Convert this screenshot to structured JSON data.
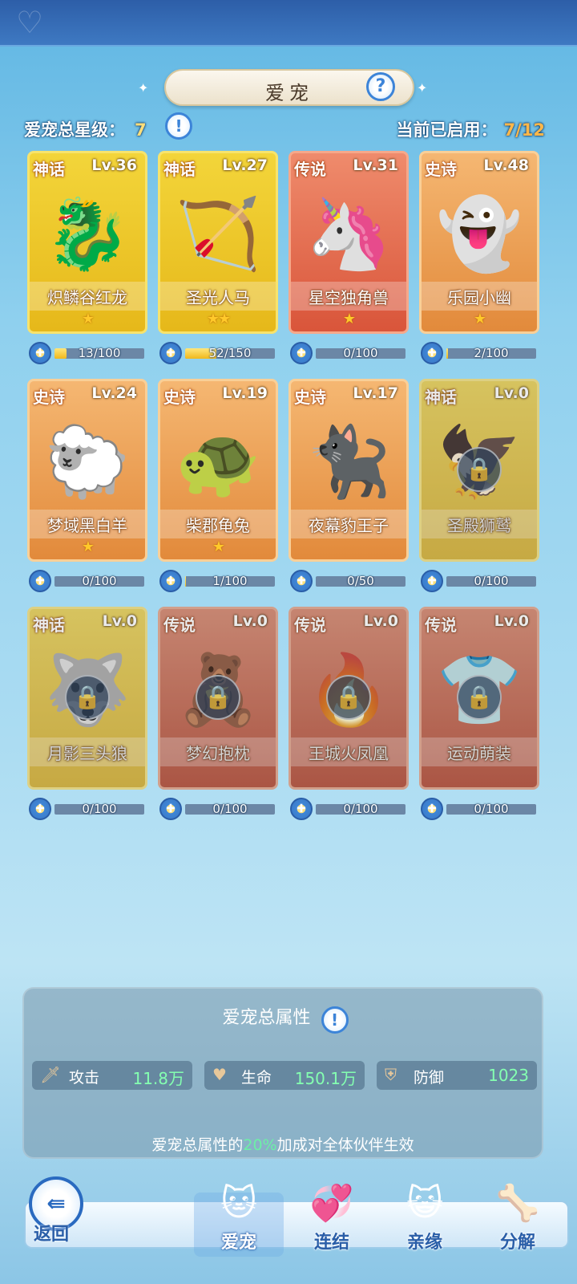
{
  "header": {
    "title": "爱宠",
    "total_star_label": "爱宠总星级：",
    "total_star_value": "7",
    "active_label": "当前已启用：",
    "active_value": "7/12"
  },
  "pets": [
    {
      "rarity": "神话",
      "level": "Lv.36",
      "name": "炽鳞谷红龙",
      "stars": "★",
      "progress": "13/100",
      "fill": 0.13,
      "tier": "myth",
      "locked": false,
      "art": "🐉"
    },
    {
      "rarity": "神话",
      "level": "Lv.27",
      "name": "圣光人马",
      "stars": "★★",
      "progress": "52/150",
      "fill": 0.35,
      "tier": "myth",
      "locked": false,
      "art": "🏹"
    },
    {
      "rarity": "传说",
      "level": "Lv.31",
      "name": "星空独角兽",
      "stars": "★",
      "progress": "0/100",
      "fill": 0.0,
      "tier": "legend",
      "locked": false,
      "art": "🦄"
    },
    {
      "rarity": "史诗",
      "level": "Lv.48",
      "name": "乐园小幽",
      "stars": "★",
      "progress": "2/100",
      "fill": 0.02,
      "tier": "epic",
      "locked": false,
      "art": "👻"
    },
    {
      "rarity": "史诗",
      "level": "Lv.24",
      "name": "梦域黑白羊",
      "stars": "★",
      "progress": "0/100",
      "fill": 0.0,
      "tier": "epic",
      "locked": false,
      "art": "🐑"
    },
    {
      "rarity": "史诗",
      "level": "Lv.19",
      "name": "柴郡龟兔",
      "stars": "★",
      "progress": "1/100",
      "fill": 0.01,
      "tier": "epic",
      "locked": false,
      "art": "🐢"
    },
    {
      "rarity": "史诗",
      "level": "Lv.17",
      "name": "夜幕豹王子",
      "stars": "",
      "progress": "0/50",
      "fill": 0.0,
      "tier": "epic",
      "locked": false,
      "art": "🐈‍⬛"
    },
    {
      "rarity": "神话",
      "level": "Lv.0",
      "name": "圣殿狮鹫",
      "stars": "",
      "progress": "0/100",
      "fill": 0.0,
      "tier": "myth",
      "locked": true,
      "art": "🦅"
    },
    {
      "rarity": "神话",
      "level": "Lv.0",
      "name": "月影三头狼",
      "stars": "",
      "progress": "0/100",
      "fill": 0.0,
      "tier": "myth",
      "locked": true,
      "art": "🐺"
    },
    {
      "rarity": "传说",
      "level": "Lv.0",
      "name": "梦幻抱枕",
      "stars": "",
      "progress": "0/100",
      "fill": 0.0,
      "tier": "legend",
      "locked": true,
      "art": "🧸"
    },
    {
      "rarity": "传说",
      "level": "Lv.0",
      "name": "王城火凤凰",
      "stars": "",
      "progress": "0/100",
      "fill": 0.0,
      "tier": "legend",
      "locked": true,
      "art": "🔥"
    },
    {
      "rarity": "传说",
      "level": "Lv.0",
      "name": "运动萌装",
      "stars": "",
      "progress": "0/100",
      "fill": 0.0,
      "tier": "legend",
      "locked": true,
      "art": "👕"
    }
  ],
  "attributes": {
    "title": "爱宠总属性",
    "items": [
      {
        "label": "攻击",
        "value": "11.8万",
        "icon": "sword-icon"
      },
      {
        "label": "生命",
        "value": "150.1万",
        "icon": "heart-icon"
      },
      {
        "label": "防御",
        "value": "1023",
        "icon": "shield-icon"
      }
    ],
    "note_prefix": "爱宠总属性的",
    "note_pct": "20%",
    "note_suffix": "加成对全体伙伴生效"
  },
  "bottom_nav": {
    "back": "返回",
    "tabs": [
      {
        "label": "爱宠",
        "icon": "cat-pet-icon",
        "active": true
      },
      {
        "label": "连结",
        "icon": "heart-link-icon",
        "active": false
      },
      {
        "label": "亲缘",
        "icon": "cat-family-icon",
        "active": false
      },
      {
        "label": "分解",
        "icon": "bone-decompose-icon",
        "active": false
      }
    ]
  }
}
